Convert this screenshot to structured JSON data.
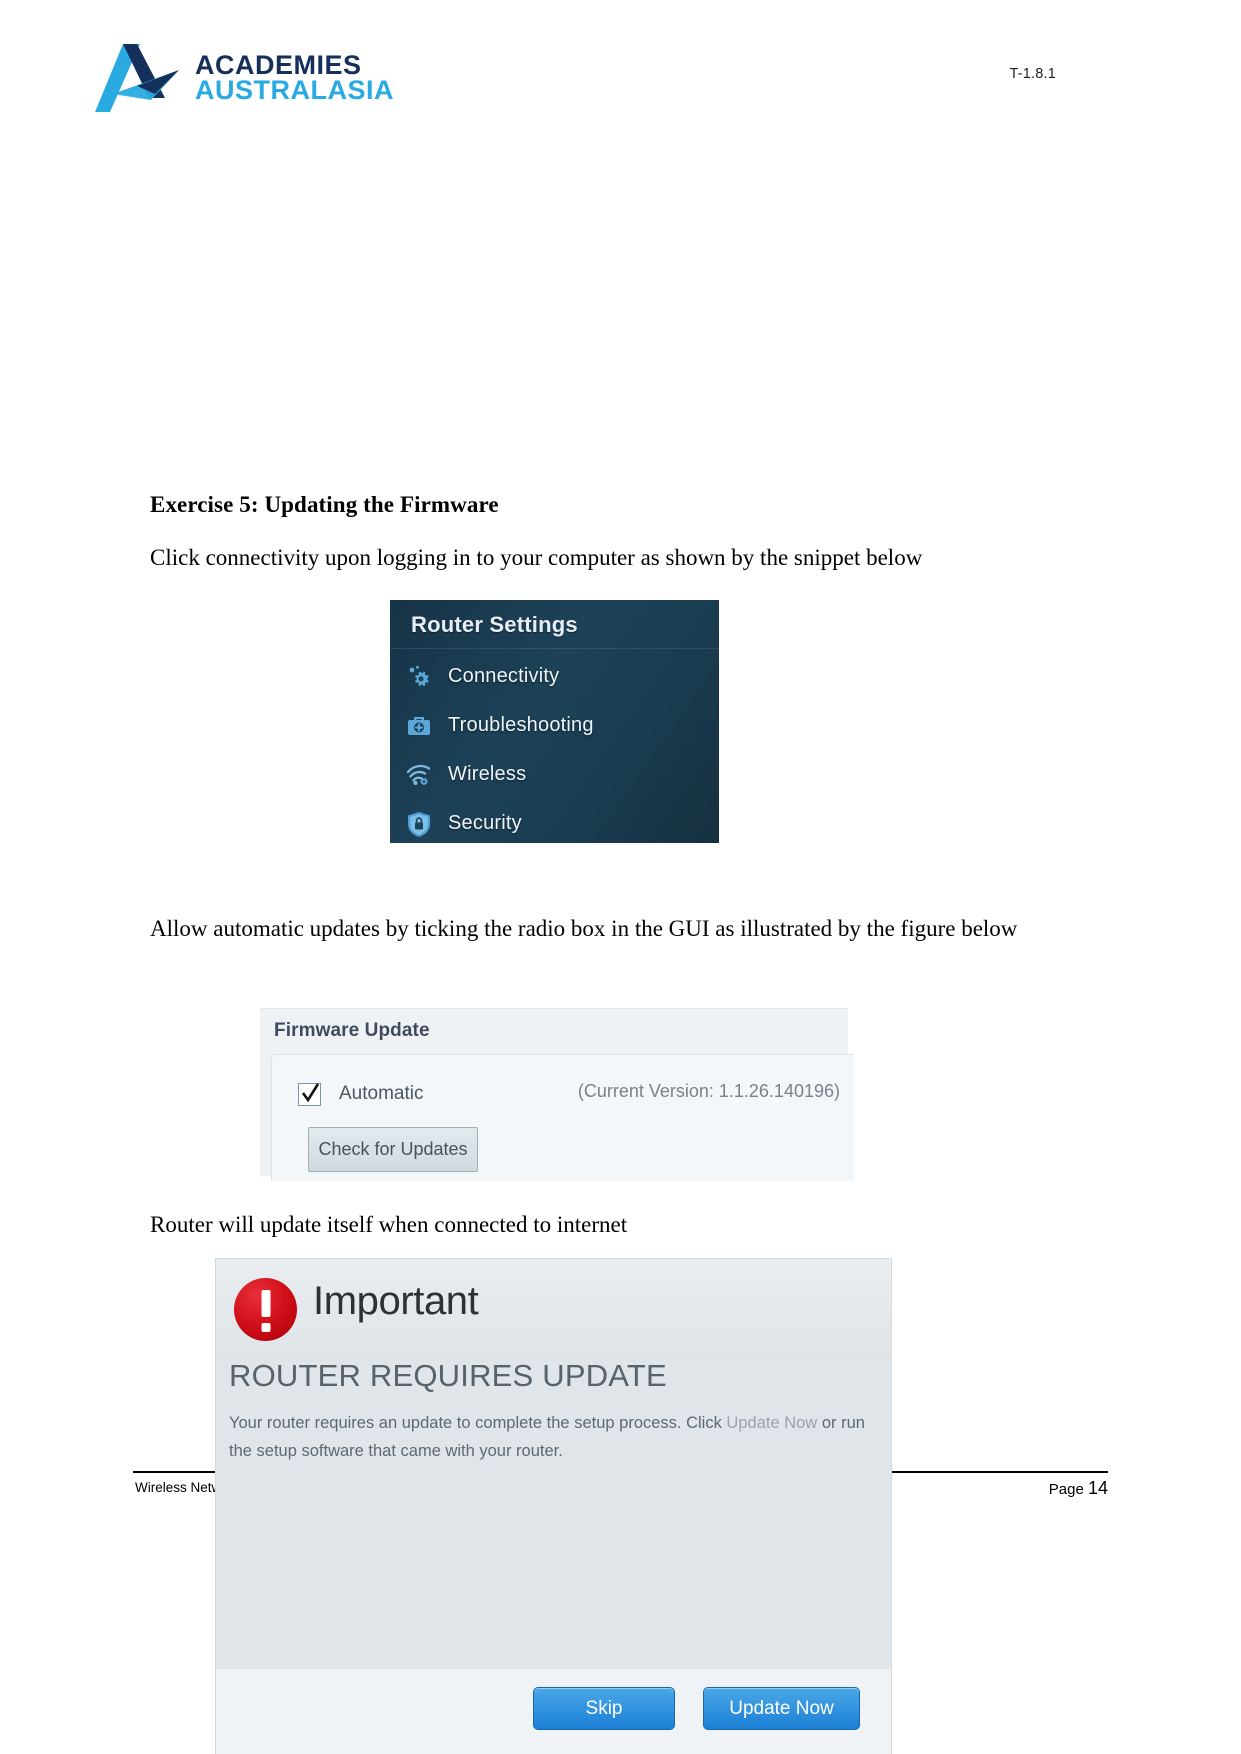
{
  "header": {
    "logo_line1": "ACADEMIES",
    "logo_line2": "AUSTRALASIA",
    "doc_code": "T-1.8.1"
  },
  "document": {
    "heading": "Exercise 5: Updating the Firmware",
    "paragraph_1": "Click connectivity upon logging in to your computer as shown by the snippet below",
    "paragraph_2": "Allow automatic updates by ticking the radio box in the GUI as illustrated by the figure below",
    "paragraph_3": "Router will update itself when connected to internet"
  },
  "router_panel": {
    "title": "Router Settings",
    "items": [
      {
        "label": "Connectivity",
        "icon": "gear-icon"
      },
      {
        "label": "Troubleshooting",
        "icon": "toolbox-icon"
      },
      {
        "label": "Wireless",
        "icon": "wifi-icon"
      },
      {
        "label": "Security",
        "icon": "shield-lock-icon"
      }
    ]
  },
  "firmware_panel": {
    "title": "Firmware Update",
    "automatic_label": "Automatic",
    "automatic_checked": true,
    "version_text": "(Current Version: 1.1.26.140196)",
    "check_button": "Check for Updates"
  },
  "dialog": {
    "title": "Important",
    "heading": "ROUTER REQUIRES UPDATE",
    "body_part1": "Your router requires an update to complete the setup process. Click ",
    "body_highlight": "Update Now",
    "body_part2": " or run the setup software that came with your router.",
    "skip_button": "Skip",
    "update_button": "Update Now"
  },
  "footer": {
    "left_text": "Wireless Netw",
    "page_label": "Page ",
    "page_number": "14"
  },
  "colors": {
    "brand_dark": "#16305c",
    "brand_light": "#29abe2",
    "panel_dark": "#1d4258",
    "alert_red": "#d10f19",
    "button_blue": "#1b7fd4"
  }
}
